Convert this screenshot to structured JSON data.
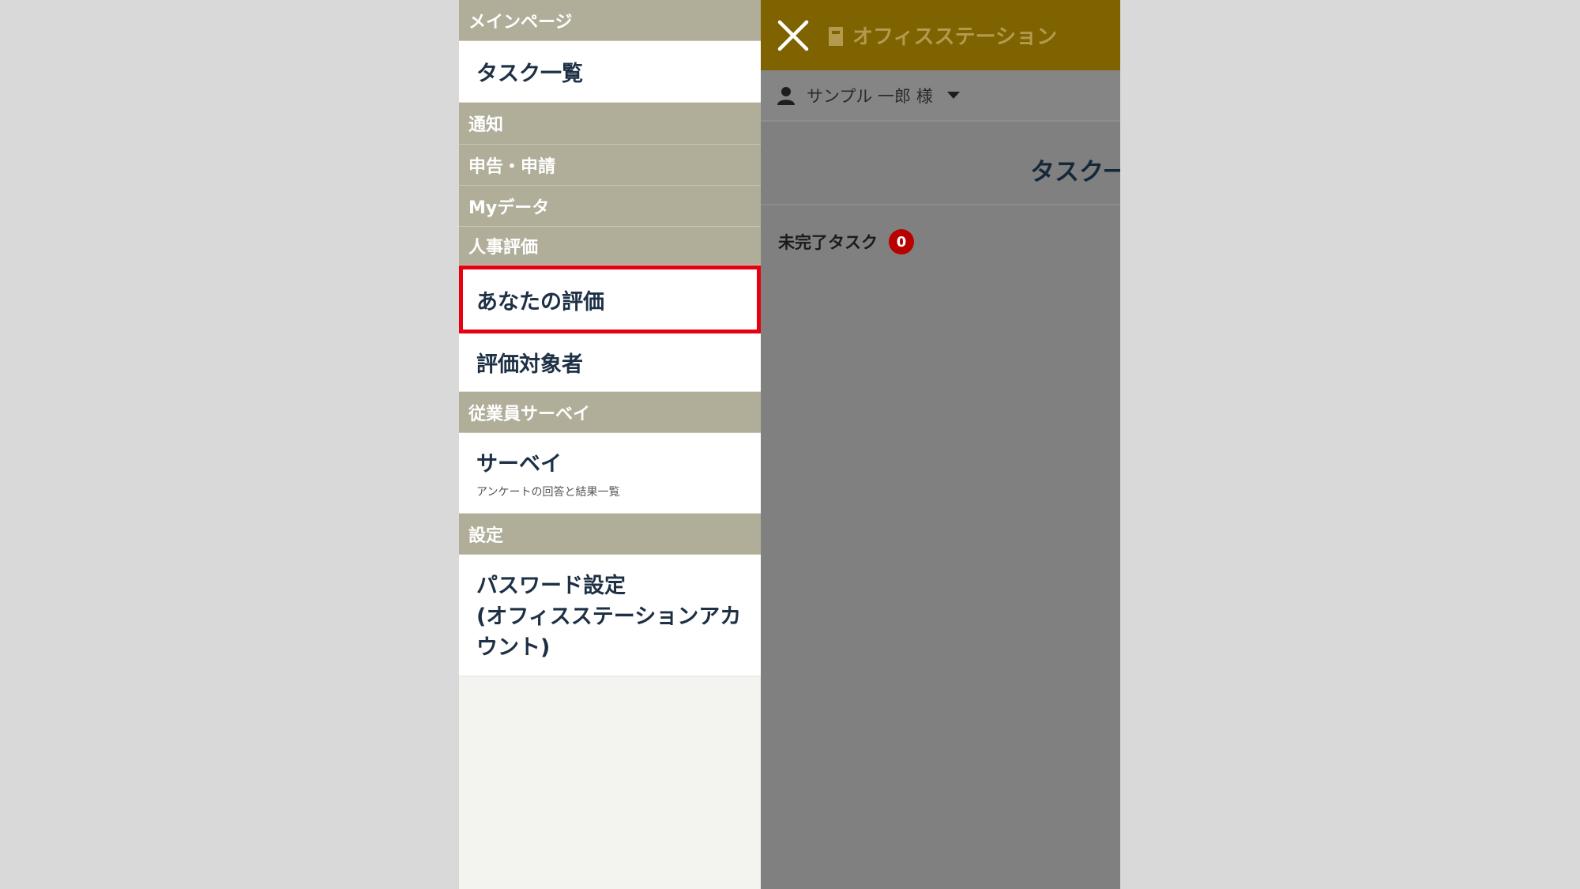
{
  "menu": {
    "main_page": "メインページ",
    "task_list": "タスク一覧",
    "notification": "通知",
    "application": "申告・申請",
    "my_data": "Myデータ",
    "hr_evaluation": "人事評価",
    "your_evaluation": "あなたの評価",
    "evaluation_targets": "評価対象者",
    "employee_survey": "従業員サーベイ",
    "survey": "サーベイ",
    "survey_sub": "アンケートの回答と結果一覧",
    "settings": "設定",
    "password_line1": "パスワード設定",
    "password_line2": "(オフィスステーションアカ",
    "password_line3": "ウント)"
  },
  "header": {
    "brand": "オフィスステーション",
    "user_name": "サンプル 一郎 様"
  },
  "main": {
    "page_title": "タスク一",
    "pending_label": "未完了タスク",
    "pending_count": "0"
  },
  "colors": {
    "section_bg": "#b0ad99",
    "app_bar": "#7f6300",
    "highlight": "#e60012",
    "badge": "#b80000"
  }
}
